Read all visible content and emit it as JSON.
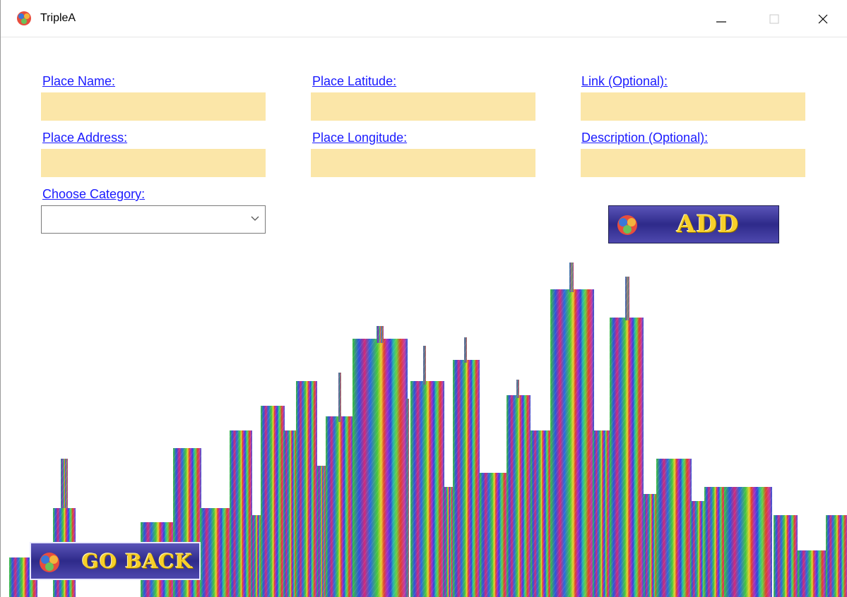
{
  "window": {
    "title": "TripleA"
  },
  "form": {
    "place_name_label": "Place Name:",
    "place_address_label": "Place Address:",
    "choose_category_label": "Choose Category:",
    "place_latitude_label": "Place Latitude:",
    "place_longitude_label": "Place Longitude:",
    "link_label": "Link (Optional):",
    "description_label": "Description (Optional):",
    "place_name_value": "",
    "place_address_value": "",
    "place_latitude_value": "",
    "place_longitude_value": "",
    "link_value": "",
    "description_value": "",
    "category_selected": ""
  },
  "buttons": {
    "add_label": "ADD",
    "go_back_label": "GO BACK"
  },
  "colors": {
    "field_background": "#fbe6a8",
    "label_color": "#1a1aff",
    "button_background": "#3e389e",
    "button_text": "#f7cf2a"
  },
  "icons": {
    "app": "triplea-logo-icon",
    "minimize": "minimize-icon",
    "maximize": "maximize-icon",
    "close": "close-icon",
    "dropdown": "chevron-down-icon"
  }
}
